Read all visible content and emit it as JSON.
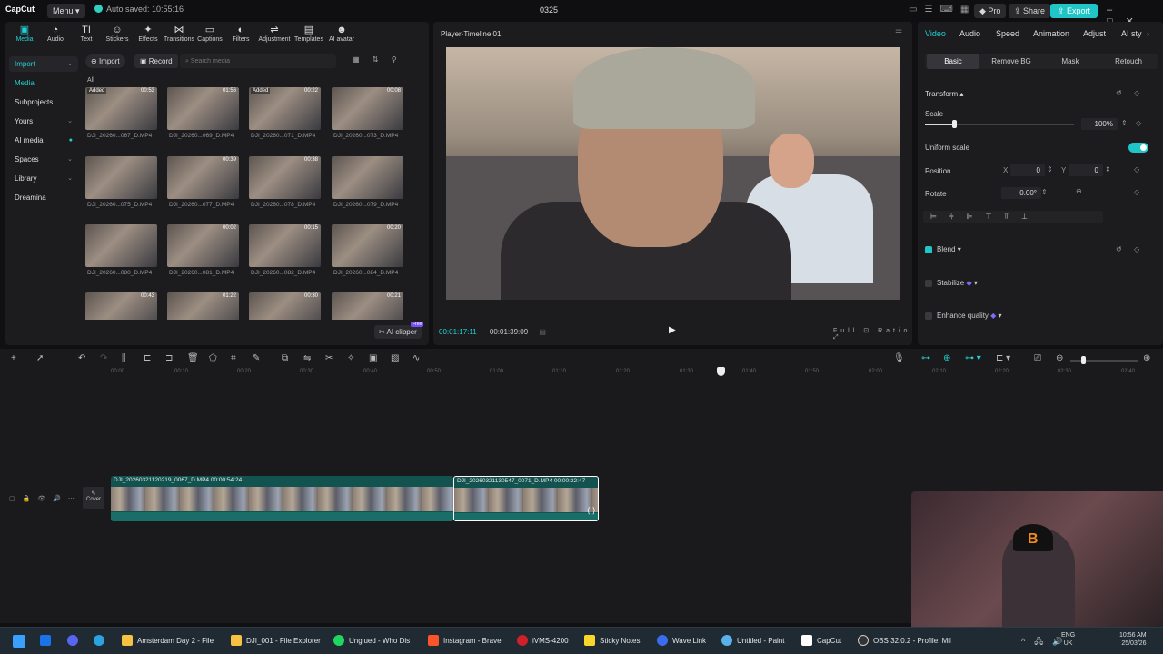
{
  "titlebar": {
    "logo": "CapCut",
    "menu_label": "Menu ▾",
    "autosave_text": "Auto saved: 10:55:16",
    "project_title": "0325",
    "pro_label": "Pro",
    "share_label": "Share",
    "export_label": "Export"
  },
  "toolbar": {
    "tabs": [
      {
        "label": "Media",
        "icon": "▣"
      },
      {
        "label": "Audio",
        "icon": "◔"
      },
      {
        "label": "Text",
        "icon": "TI"
      },
      {
        "label": "Stickers",
        "icon": "☺"
      },
      {
        "label": "Effects",
        "icon": "✦"
      },
      {
        "label": "Transitions",
        "icon": "⋈"
      },
      {
        "label": "Captions",
        "icon": "▭"
      },
      {
        "label": "Filters",
        "icon": "◐"
      },
      {
        "label": "Adjustment",
        "icon": "⇌"
      },
      {
        "label": "Templates",
        "icon": "▤"
      },
      {
        "label": "AI avatar",
        "icon": "☻"
      }
    ]
  },
  "sidebar": {
    "items": [
      {
        "label": "Import"
      },
      {
        "label": "Media"
      },
      {
        "label": "Subprojects"
      },
      {
        "label": "Yours"
      },
      {
        "label": "AI media"
      },
      {
        "label": "Spaces"
      },
      {
        "label": "Library"
      },
      {
        "label": "Dreamina"
      }
    ]
  },
  "media": {
    "import_label": "Import",
    "record_label": "Record",
    "search_placeholder": "Search media",
    "all_label": "All",
    "ai_clipper_label": "AI clipper",
    "free_badge": "Free",
    "thumbs": [
      {
        "name": "DJI_20260...067_D.MP4",
        "duration": "00:53",
        "added": "Added"
      },
      {
        "name": "DJI_20260...069_D.MP4",
        "duration": "01:56",
        "added": ""
      },
      {
        "name": "DJI_20260...071_D.MP4",
        "duration": "00:22",
        "added": "Added"
      },
      {
        "name": "DJI_20260...073_D.MP4",
        "duration": "00:08",
        "added": ""
      },
      {
        "name": "DJI_20260...075_D.MP4",
        "duration": "",
        "added": ""
      },
      {
        "name": "DJI_20260...077_D.MP4",
        "duration": "00:39",
        "added": ""
      },
      {
        "name": "DJI_20260...078_D.MP4",
        "duration": "00:38",
        "added": ""
      },
      {
        "name": "DJI_20260...079_D.MP4",
        "duration": "",
        "added": ""
      },
      {
        "name": "DJI_20260...080_D.MP4",
        "duration": "",
        "added": ""
      },
      {
        "name": "DJI_20260...081_D.MP4",
        "duration": "00:02",
        "added": ""
      },
      {
        "name": "DJI_20260...082_D.MP4",
        "duration": "00:15",
        "added": ""
      },
      {
        "name": "DJI_20260...084_D.MP4",
        "duration": "00:20",
        "added": ""
      },
      {
        "name": "",
        "duration": "00:43",
        "added": ""
      },
      {
        "name": "",
        "duration": "01:22",
        "added": ""
      },
      {
        "name": "",
        "duration": "00:30",
        "added": ""
      },
      {
        "name": "",
        "duration": "00:21",
        "added": ""
      }
    ]
  },
  "player": {
    "title": "Player-Timeline 01",
    "current_time": "00:01:17:11",
    "total_time": "00:01:39:09",
    "full_label": "Full",
    "ratio_label": "Ratio"
  },
  "props": {
    "tabs": [
      {
        "label": "Video"
      },
      {
        "label": "Audio"
      },
      {
        "label": "Speed"
      },
      {
        "label": "Animation"
      },
      {
        "label": "Adjust"
      },
      {
        "label": "AI sty"
      }
    ],
    "sub_tabs": [
      {
        "label": "Basic"
      },
      {
        "label": "Remove BG"
      },
      {
        "label": "Mask"
      },
      {
        "label": "Retouch"
      }
    ],
    "transform_label": "Transform",
    "scale_label": "Scale",
    "scale_value": "100%",
    "scale_level": 0.1,
    "uniform_scale_label": "Uniform scale",
    "position_label": "Position",
    "pos_x_label": "X",
    "pos_x": "0",
    "pos_y_label": "Y",
    "pos_y": "0",
    "rotate_label": "Rotate",
    "rotate_value": "0.00°",
    "blend_label": "Blend",
    "stabilize_label": "Stabilize",
    "enhance_label": "Enhance quality"
  },
  "timeline": {
    "ticks": [
      "00:00",
      "00:10",
      "00:20",
      "00:30",
      "00:40",
      "00:50",
      "01:00",
      "01:10",
      "01:20",
      "01:30",
      "01:40",
      "01:50",
      "02:00",
      "02:10",
      "02:20",
      "02:30",
      "02:40"
    ],
    "cover_label": "Cover",
    "clips": [
      {
        "label": "DJI_20260321120219_0067_D.MP4   00:00:54:24"
      },
      {
        "label": "DJI_20260321130547_0071_D.MP4   00:00:22:47"
      }
    ]
  },
  "taskbar": {
    "items": [
      {
        "label": "Amsterdam Day 2 - File",
        "color": "#f5c242"
      },
      {
        "label": "DJI_001 - File Explorer",
        "color": "#f5c242"
      },
      {
        "label": "Unglued - Who Dis",
        "color": "#1ed760"
      },
      {
        "label": "Instagram - Brave",
        "color": "#fb542b"
      },
      {
        "label": "iVMS-4200",
        "color": "#d0202a"
      },
      {
        "label": "Sticky Notes",
        "color": "#f7d82a"
      },
      {
        "label": "Wave Link",
        "color": "#3b6cf0"
      },
      {
        "label": "Untitled - Paint",
        "color": "#5ab0e8"
      },
      {
        "label": "CapCut",
        "color": "#ffffff"
      },
      {
        "label": "OBS 32.0.2 - Profile: Mil",
        "color": "#333333"
      }
    ],
    "lang_top": "ENG",
    "lang_bottom": "UK",
    "time": "10:56 AM",
    "date": "25/03/26"
  }
}
